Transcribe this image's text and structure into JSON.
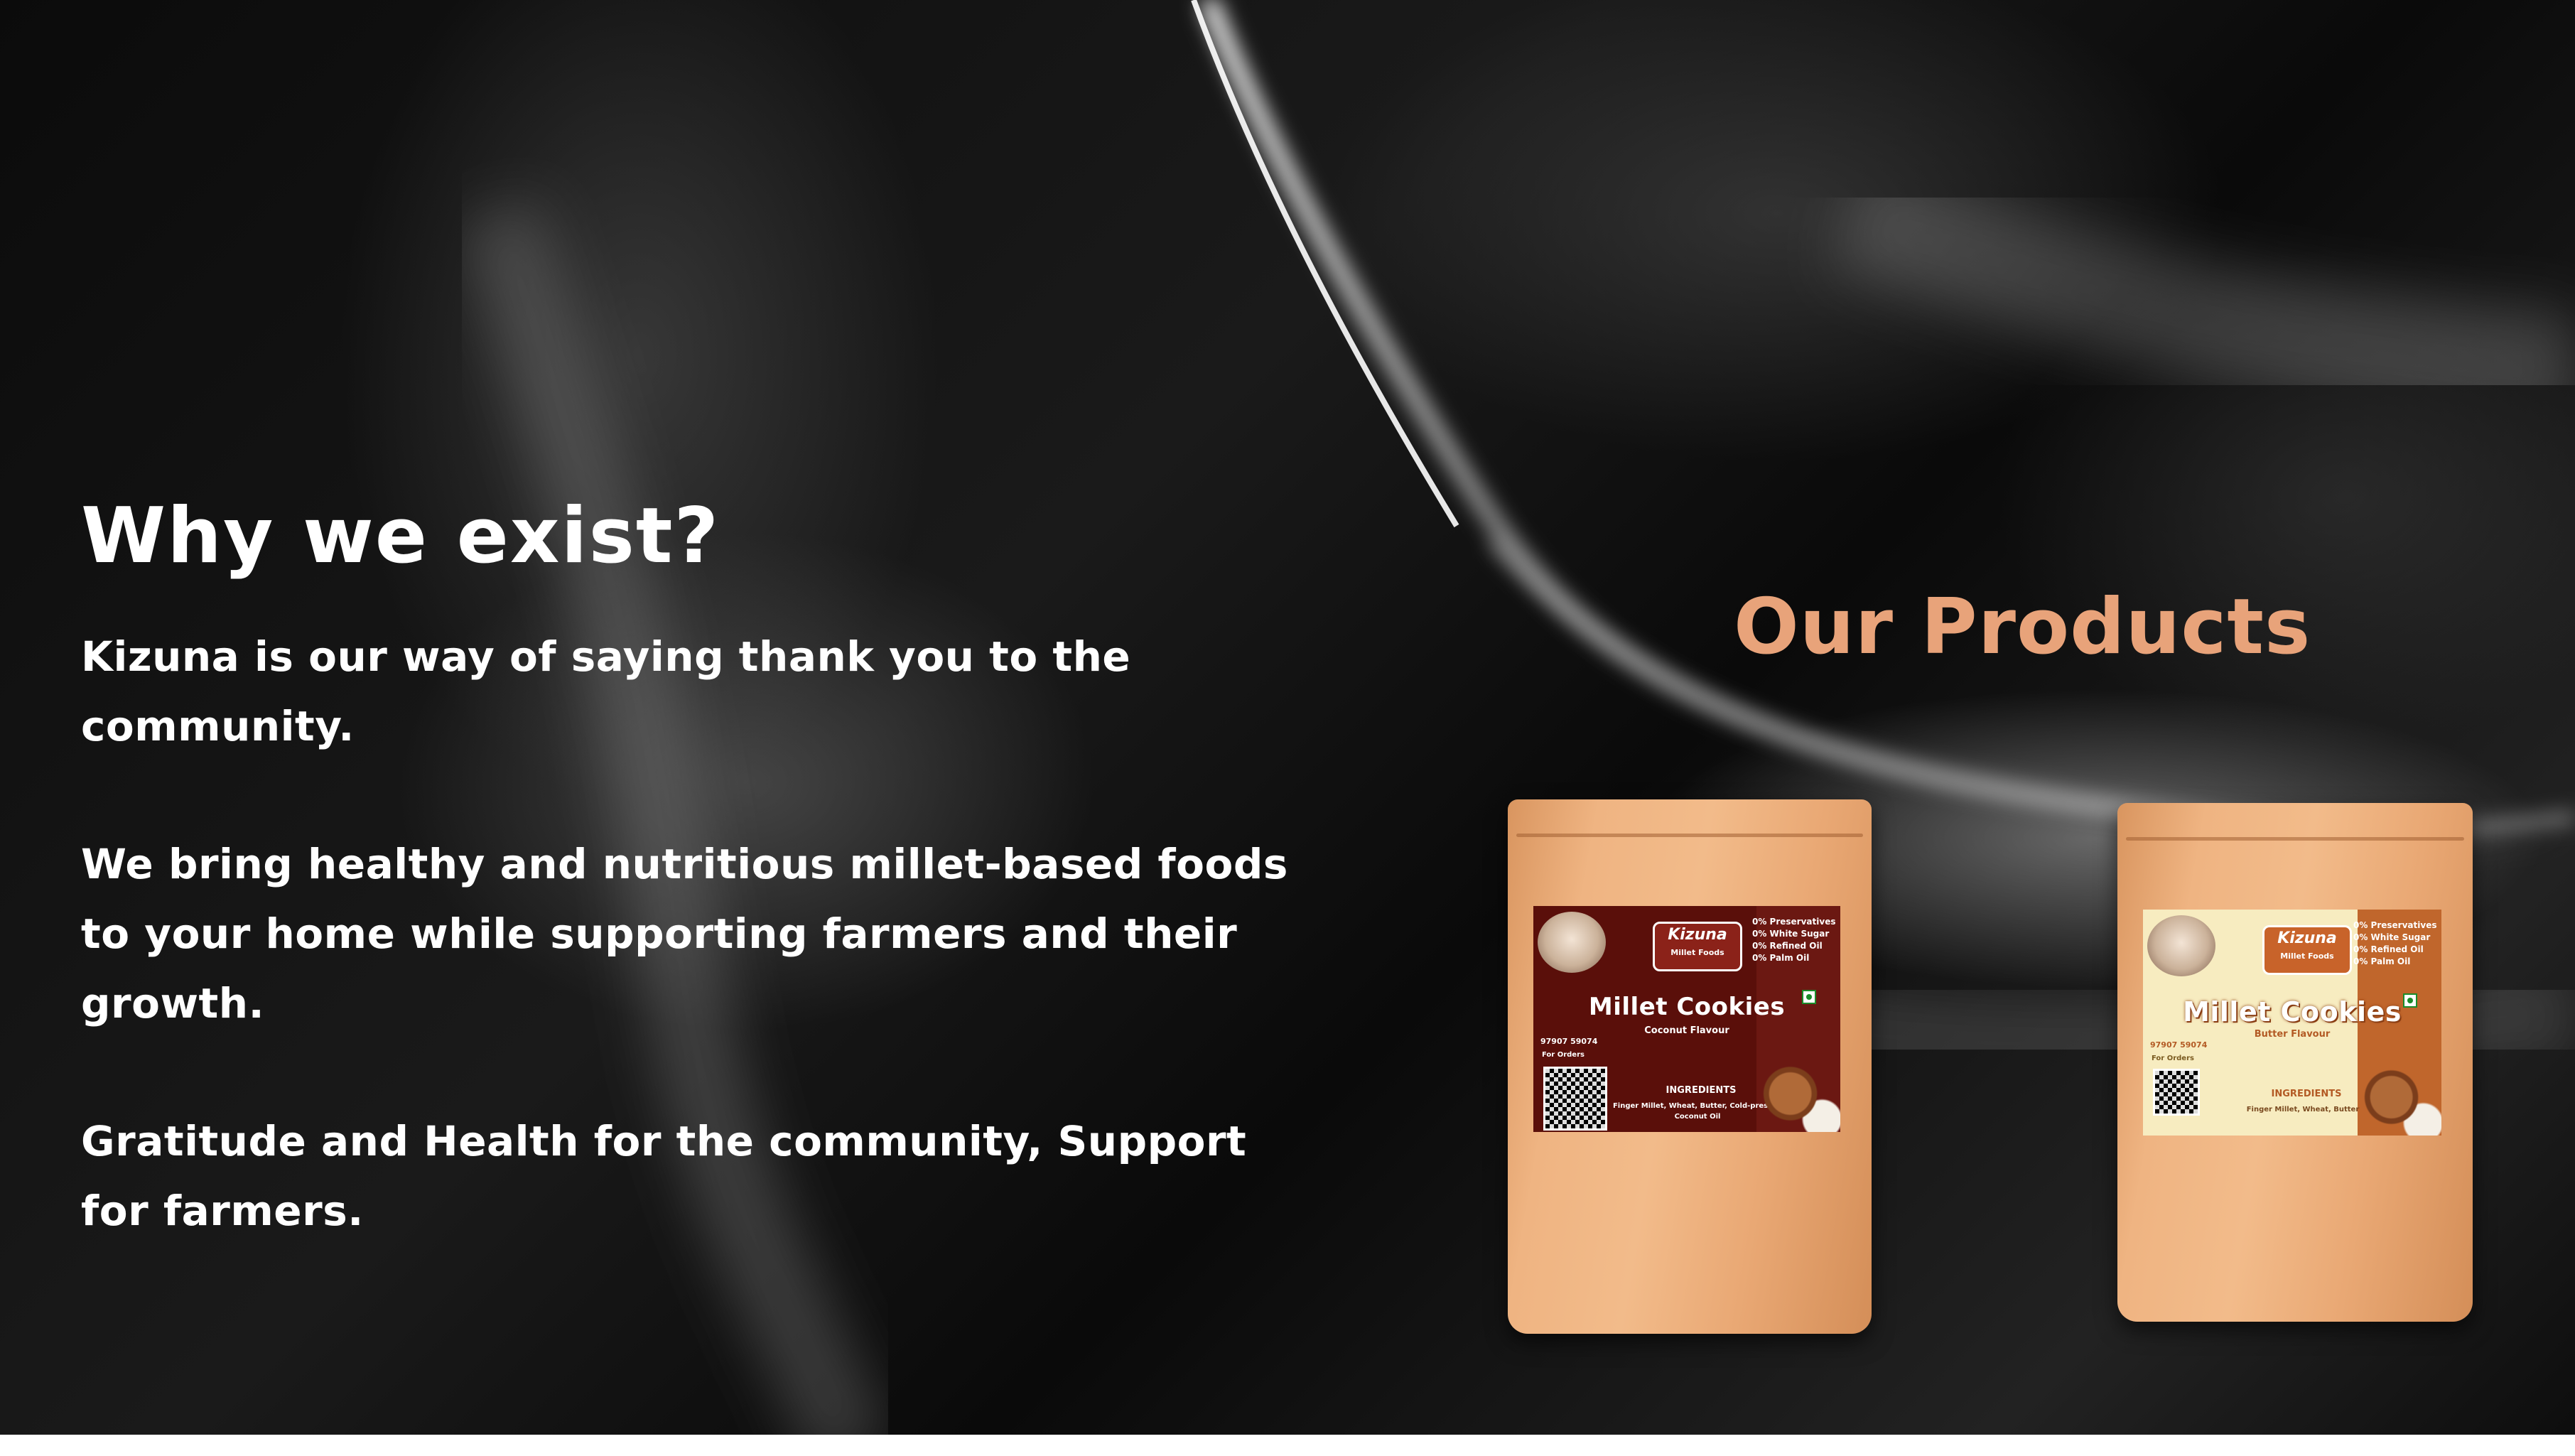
{
  "left": {
    "heading": "Why we exist?",
    "paragraphs": [
      "Kizuna is our way of saying thank you to the community.",
      "We bring healthy and nutritious millet-based foods to your home while supporting farmers and their growth.",
      "Gratitude and Health for the community, Support for farmers."
    ]
  },
  "products": {
    "title": "Our Products",
    "items": [
      {
        "brand": "Kizuna",
        "brand_sub": "Millet Foods",
        "name": "Millet Cookies",
        "flavour": "Coconut Flavour",
        "claims": [
          "0% Preservatives",
          "0% White Sugar",
          "0% Refined Oil",
          "0% Palm Oil"
        ],
        "phone": "97907 59074",
        "for_orders": "For Orders",
        "ingredients_title": "INGREDIENTS",
        "ingredients": "Finger Millet, Wheat, Butter, Cold-pressed Coconut Oil",
        "label_color": "#5a0f0a"
      },
      {
        "brand": "Kizuna",
        "brand_sub": "Millet Foods",
        "name": "Millet Cookies",
        "flavour": "Butter Flavour",
        "claims": [
          "0% Preservatives",
          "0% White Sugar",
          "0% Refined Oil",
          "0% Palm Oil"
        ],
        "phone": "97907 59074",
        "for_orders": "For Orders",
        "ingredients_title": "INGREDIENTS",
        "ingredients": "Finger Millet, Wheat, Butter",
        "label_color": "#f7ecc0"
      }
    ]
  },
  "colors": {
    "accent": "#e8a37a",
    "text": "#ffffff",
    "background": "#050505"
  }
}
